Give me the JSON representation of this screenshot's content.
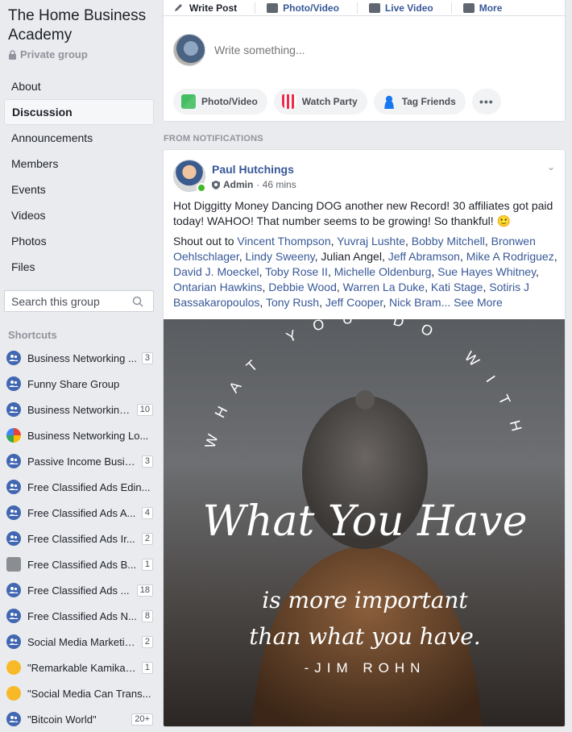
{
  "group": {
    "title": "The Home Business Academy",
    "privacy": "Private group"
  },
  "nav": [
    {
      "label": "About",
      "active": false
    },
    {
      "label": "Discussion",
      "active": true
    },
    {
      "label": "Announcements",
      "active": false
    },
    {
      "label": "Members",
      "active": false
    },
    {
      "label": "Events",
      "active": false
    },
    {
      "label": "Videos",
      "active": false
    },
    {
      "label": "Photos",
      "active": false
    },
    {
      "label": "Files",
      "active": false
    }
  ],
  "search": {
    "placeholder": "Search this group"
  },
  "shortcuts": {
    "title": "Shortcuts",
    "items": [
      {
        "label": "Business Networking ...",
        "badge": "3",
        "icon": "group-icon"
      },
      {
        "label": "Funny Share Group",
        "badge": "",
        "icon": "group-icon"
      },
      {
        "label": "Business Networking...",
        "badge": "10",
        "icon": "group-icon"
      },
      {
        "label": "Business Networking Lo...",
        "badge": "",
        "icon": "multicolor-logo-icon"
      },
      {
        "label": "Passive Income Busin...",
        "badge": "3",
        "icon": "group-icon"
      },
      {
        "label": "Free Classified Ads Edin...",
        "badge": "",
        "icon": "group-icon"
      },
      {
        "label": "Free Classified Ads A...",
        "badge": "4",
        "icon": "group-icon"
      },
      {
        "label": "Free Classified Ads Ir...",
        "badge": "2",
        "icon": "group-icon"
      },
      {
        "label": "Free Classified Ads B...",
        "badge": "1",
        "icon": "megaphone-icon"
      },
      {
        "label": "Free Classified Ads ...",
        "badge": "18",
        "icon": "group-icon"
      },
      {
        "label": "Free Classified Ads N...",
        "badge": "8",
        "icon": "group-icon"
      },
      {
        "label": "Social Media Marketin...",
        "badge": "2",
        "icon": "group-icon"
      },
      {
        "label": "\"Remarkable Kamikaz...",
        "badge": "1",
        "icon": "hand-icon"
      },
      {
        "label": "\"Social Media Can Trans...",
        "badge": "",
        "icon": "hand-icon"
      },
      {
        "label": "\"Bitcoin World\"",
        "badge": "20+",
        "icon": "group-icon"
      }
    ]
  },
  "composer": {
    "tabs": [
      "Write Post",
      "Photo/Video",
      "Live Video",
      "More"
    ],
    "placeholder": "Write something...",
    "actions": [
      "Photo/Video",
      "Watch Party",
      "Tag Friends"
    ],
    "more_label": "•••"
  },
  "feed": {
    "section_label": "FROM NOTIFICATIONS"
  },
  "post": {
    "author": "Paul Hutchings",
    "role": "Admin",
    "time": "· 46 mins",
    "body": "Hot Diggitty Money Dancing DOG another new Record! 30 affiliates got paid today! WAHOO! That number seems to be growing! So thankful! 🙂",
    "shout_prefix": "Shout out to",
    "mentions": [
      "Vincent Thompson",
      "Yuvraj Lushte",
      "Bobby Mitchell",
      "Bronwen Oehlschlager",
      "Lindy Sweeny",
      "Julian Angel",
      "Jeff Abramson",
      "Mike A Rodriguez",
      "David J. Moeckel",
      "Toby Rose II",
      "Michelle Oldenburg",
      "Sue Hayes Whitney",
      "Ontarian Hawkins",
      "Debbie Wood",
      "Warren La Duke",
      "Kati Stage",
      "Sotiris J Bassakaropoulos",
      "Tony Rush",
      "Jeff Cooper",
      "Nick Bram..."
    ],
    "plain_mentions": [
      "Julian Angel"
    ],
    "see_more": "See More",
    "image": {
      "arc_text": "WHAT YOU DO WITH",
      "script_line": "What You Have",
      "line2": "is more important",
      "line3": "than what you have.",
      "attribution": "-JIM ROHN"
    }
  }
}
